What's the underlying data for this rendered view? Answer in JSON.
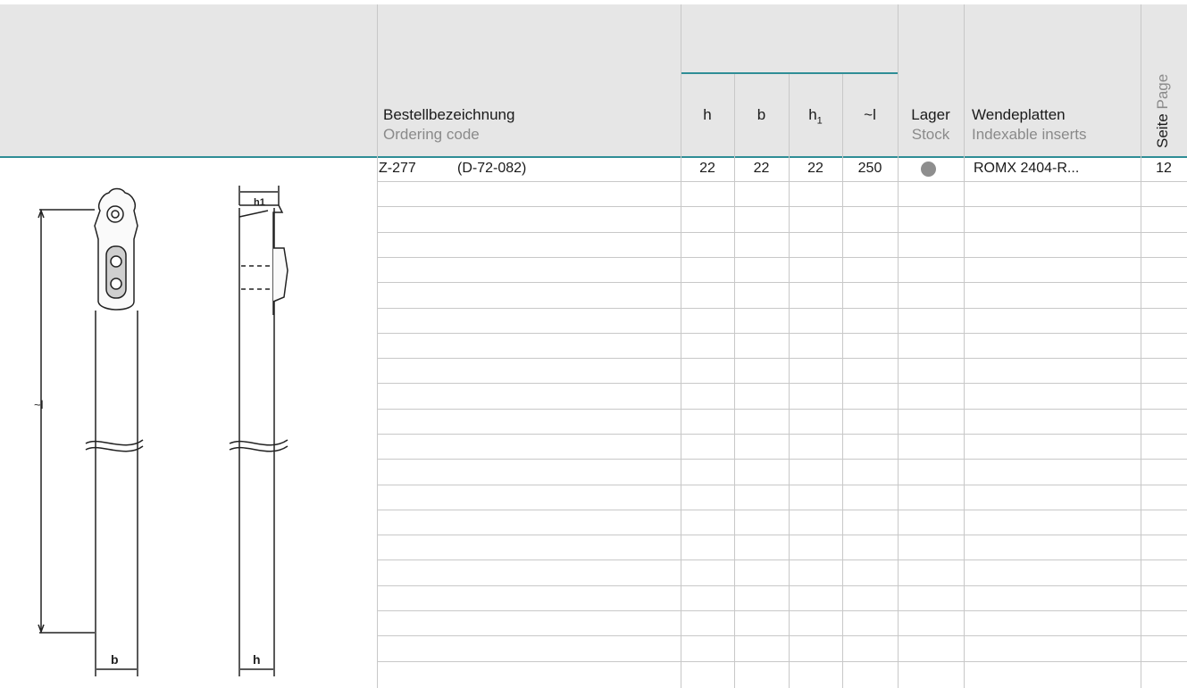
{
  "header": {
    "ordering_de": "Bestellbezeichnung",
    "ordering_en": "Ordering code",
    "col_h": "h",
    "col_b": "b",
    "col_h1_base": "h",
    "col_h1_sub": "1",
    "col_l": "~l",
    "stock_de": "Lager",
    "stock_en": "Stock",
    "inserts_de": "Wendeplatten",
    "inserts_en": "Indexable inserts",
    "page_de": "Seite",
    "page_en": "Page"
  },
  "rows": [
    {
      "code": "Z-277",
      "ref": "(D-72-082)",
      "h": "22",
      "b": "22",
      "h1": "22",
      "l": "250",
      "stock": "in-stock-dot",
      "insert": "ROMX 2404-R...",
      "page": "12"
    }
  ],
  "drawing_labels": {
    "length": "~l",
    "width_b": "b",
    "height_h": "h",
    "height_h1": "h1"
  },
  "colors": {
    "accent": "#2f8e96",
    "header_bg": "#e6e6e6",
    "grid": "#c8c8c8",
    "stock_dot": "#8e8e8e"
  }
}
